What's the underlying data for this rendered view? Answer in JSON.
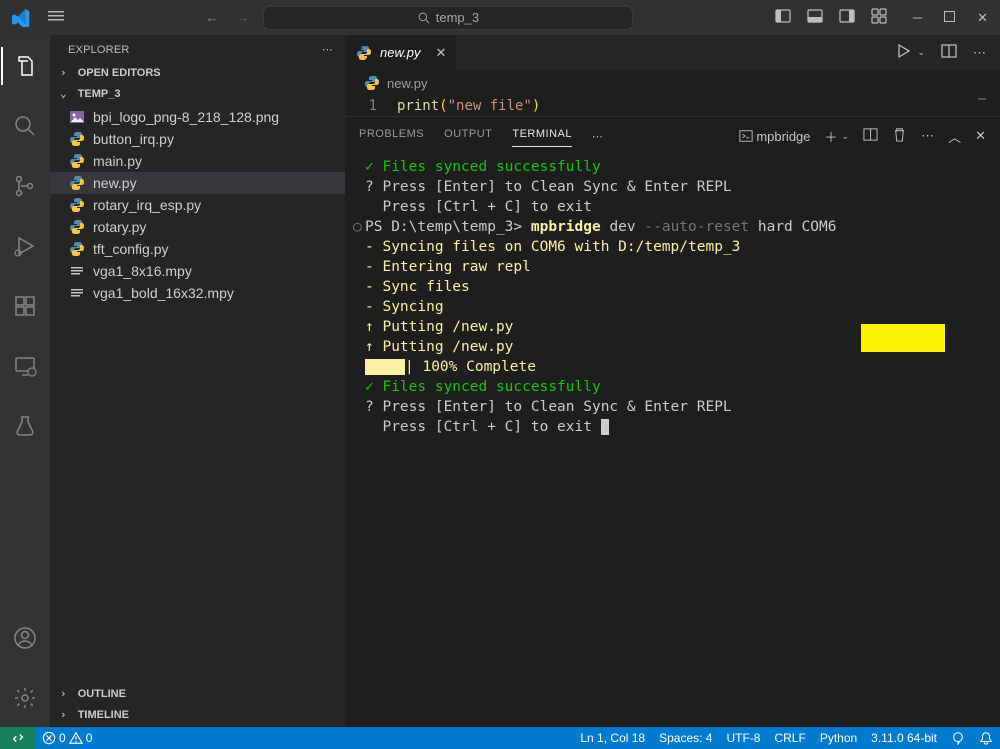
{
  "titlebar": {
    "search_placeholder": "temp_3"
  },
  "sidebar": {
    "header": "EXPLORER",
    "open_editors": "OPEN EDITORS",
    "folder": "TEMP_3",
    "files": [
      {
        "name": "bpi_logo_png-8_218_128.png",
        "icon": "image",
        "selected": false
      },
      {
        "name": "button_irq.py",
        "icon": "python",
        "selected": false
      },
      {
        "name": "main.py",
        "icon": "python",
        "selected": false
      },
      {
        "name": "new.py",
        "icon": "python",
        "selected": true
      },
      {
        "name": "rotary_irq_esp.py",
        "icon": "python",
        "selected": false
      },
      {
        "name": "rotary.py",
        "icon": "python",
        "selected": false
      },
      {
        "name": "tft_config.py",
        "icon": "python",
        "selected": false
      },
      {
        "name": "vga1_8x16.mpy",
        "icon": "generic",
        "selected": false
      },
      {
        "name": "vga1_bold_16x32.mpy",
        "icon": "generic",
        "selected": false
      }
    ],
    "outline": "OUTLINE",
    "timeline": "TIMELINE"
  },
  "editor": {
    "tab_label": "new.py",
    "breadcrumb": "new.py",
    "line_no": "1",
    "code_fn": "print",
    "code_open": "(",
    "code_str": "\"new file\"",
    "code_close": ")"
  },
  "panel": {
    "tabs": [
      "PROBLEMS",
      "OUTPUT",
      "TERMINAL"
    ],
    "selected": "TERMINAL",
    "profile": "mpbridge"
  },
  "terminal": {
    "lines": [
      {
        "cls": "g",
        "text": "✓ Files synced successfully"
      },
      {
        "cls": "w",
        "pre": "? ",
        "text": "Press [Enter] to Clean Sync & Enter REPL"
      },
      {
        "cls": "w",
        "pre": "  ",
        "text": "Press [Ctrl + C] to exit"
      },
      {
        "ps": true,
        "prompt": "PS D:\\temp\\temp_3>",
        "cmd": "mpbridge",
        "arg1": "dev",
        "flag": "--auto-reset",
        "arg2": "hard COM6"
      },
      {
        "cls": "y",
        "text": "- Syncing files on COM6 with D:/temp/temp_3"
      },
      {
        "cls": "y",
        "text": "- Entering raw repl"
      },
      {
        "cls": "y",
        "text": "- Sync files"
      },
      {
        "cls": "y",
        "text": "- Syncing"
      },
      {
        "cls": "y",
        "text": "↑ Putting /new.py"
      },
      {
        "cls": "y",
        "text": "↑ Putting /new.py"
      },
      {
        "progress": true,
        "text": "| 100% Complete"
      },
      {
        "cls": "g",
        "text": "✓ Files synced successfully"
      },
      {
        "cls": "w",
        "pre": "? ",
        "text": "Press [Enter] to Clean Sync & Enter REPL"
      },
      {
        "cls": "w",
        "pre": "  ",
        "cursor": true,
        "text": "Press [Ctrl + C] to exit"
      }
    ]
  },
  "statusbar": {
    "errors": "0",
    "warnings": "0",
    "ln_col": "Ln 1, Col 18",
    "spaces": "Spaces: 4",
    "encoding": "UTF-8",
    "eol": "CRLF",
    "lang": "Python",
    "python_ver": "3.11.0 64-bit"
  }
}
